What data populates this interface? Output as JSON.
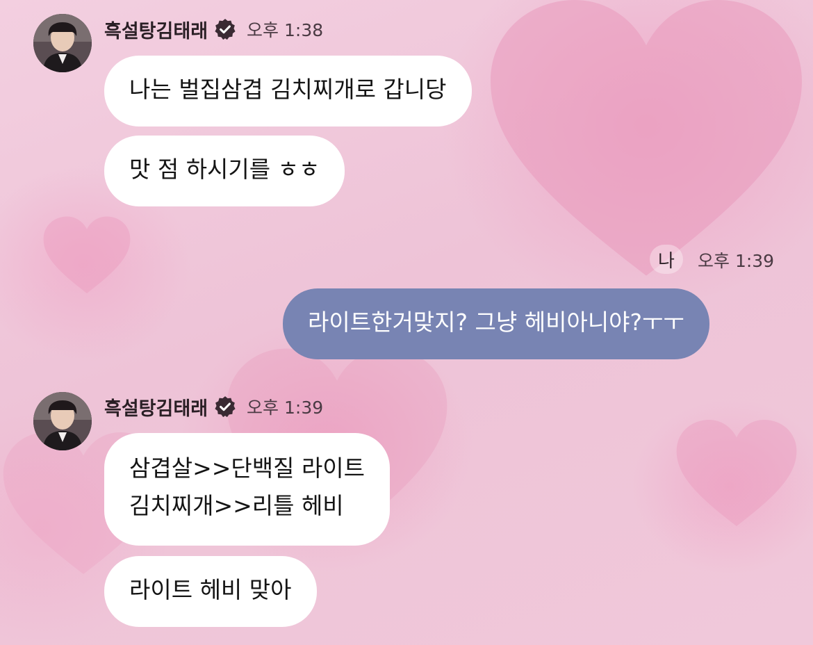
{
  "chat": {
    "group1": {
      "sender": "흑설탕김태래",
      "time": "오후 1:38",
      "messages": [
        "나는 벌집삼겹 김치찌개로 갑니당",
        "맛 점 하시기를 ㅎㅎ"
      ]
    },
    "mine": {
      "me_label": "나",
      "time": "오후 1:39",
      "message": "라이트한거맞지? 그냥 헤비아니야?ㅜㅜ",
      "bubble_color": "#7884b3"
    },
    "group2": {
      "sender": "흑설탕김태래",
      "time": "오후 1:39",
      "messages": [
        {
          "line1": "삼겹살>>단백질 라이트",
          "line2": "김치찌개>>리틀 헤비"
        },
        "라이트 헤비 맞아"
      ]
    },
    "icons": {
      "verified": "verified-badge-icon",
      "avatar": "profile-avatar"
    },
    "colors": {
      "background": "#efc6d9",
      "incoming_bubble": "#ffffff",
      "outgoing_bubble": "#7884b3"
    }
  }
}
